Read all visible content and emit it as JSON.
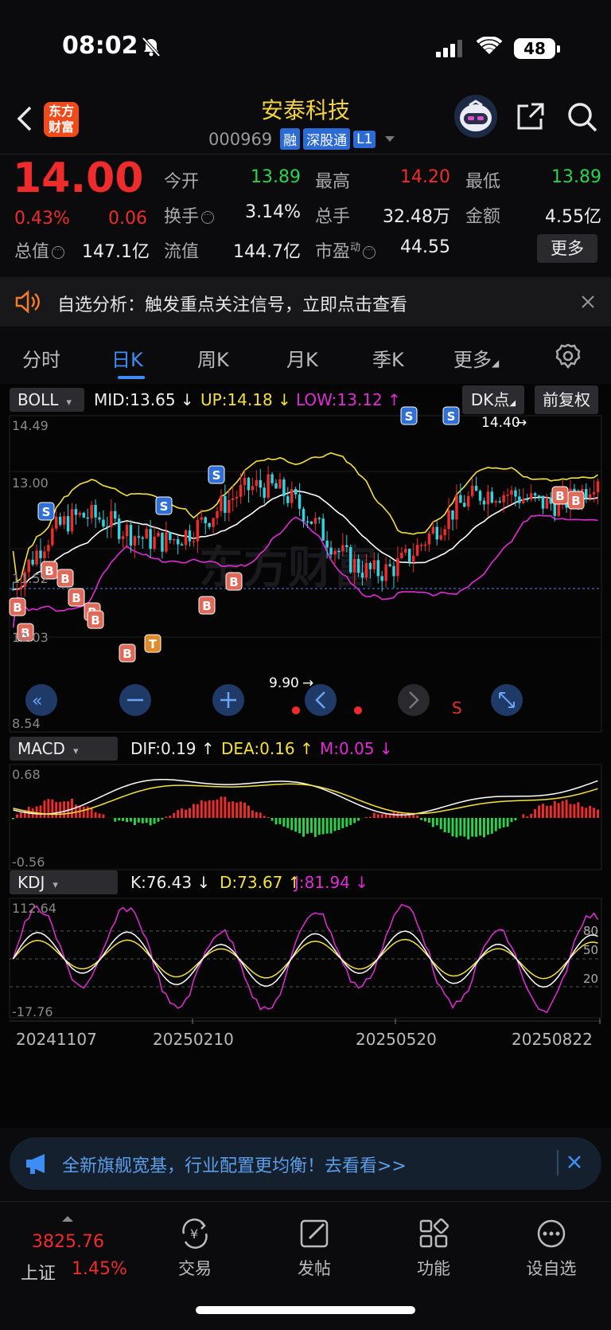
{
  "status": {
    "time": "08:02",
    "battery": "48"
  },
  "header": {
    "logo_line1": "东方",
    "logo_line2": "财富",
    "stock_name": "安泰科技",
    "stock_code": "000969",
    "tags": [
      "融",
      "深股通",
      "L1"
    ]
  },
  "quote": {
    "price": "14.00",
    "change_pct": "0.43%",
    "change": "0.06",
    "fields": [
      {
        "label": "今开",
        "value": "13.89",
        "color": "#2bd34a"
      },
      {
        "label": "最高",
        "value": "14.20",
        "color": "#f02b2b"
      },
      {
        "label": "最低",
        "value": "13.89",
        "color": "#2bd34a"
      },
      {
        "label": "换手",
        "value": "3.14%",
        "color": "#eeeeee"
      },
      {
        "label": "总手",
        "value": "32.48万",
        "color": "#eeeeee"
      },
      {
        "label": "金额",
        "value": "4.55亿",
        "color": "#eeeeee"
      },
      {
        "label": "总值",
        "value": "147.1亿",
        "color": "#eeeeee"
      },
      {
        "label": "流值",
        "value": "144.7亿",
        "color": "#eeeeee"
      },
      {
        "label": "市盈",
        "value": "44.55",
        "color": "#eeeeee"
      }
    ],
    "pe_superscript": "动",
    "more_label": "更多"
  },
  "notice": {
    "text": "自选分析：触发重点关注信号，立即点击查看"
  },
  "tabs": [
    "分时",
    "日K",
    "周K",
    "月K",
    "季K",
    "更多"
  ],
  "active_tab": "日K",
  "boll": {
    "name": "BOLL",
    "mid": "MID:13.65",
    "up": "UP:14.18",
    "low": "LOW:13.12",
    "dk_label": "DK点",
    "fq_label": "前复权",
    "y_labels": [
      "14.49",
      "13.00",
      "11.52",
      "10.03",
      "8.54"
    ],
    "high_mark": "14.40",
    "low_mark": "9.90",
    "watermark": "东方财富"
  },
  "macd": {
    "name": "MACD",
    "dif": "DIF:0.19",
    "dea": "DEA:0.16",
    "m": "M:0.05",
    "y_top": "0.68",
    "y_bottom": "-0.56"
  },
  "kdj": {
    "name": "KDJ",
    "k": "K:76.43",
    "d": "D:73.67",
    "j": "J:81.94",
    "y_top": "112.64",
    "y_bottom": "-17.76",
    "right_labels": [
      "80",
      "50",
      "20"
    ]
  },
  "dates": [
    "20241107",
    "20250210",
    "20250520",
    "20250822"
  ],
  "chart_controls": {
    "s_label": "S"
  },
  "banner": {
    "text": "全新旗舰宽基，行业配置更均衡！去看看>>"
  },
  "bottom_nav": {
    "index_price": "3825.76",
    "index_name": "上证",
    "index_pct": "1.45%",
    "items": [
      "交易",
      "发帖",
      "功能",
      "设自选"
    ]
  },
  "colors": {
    "up": "#f02b2b",
    "down": "#2bd34a",
    "mid": "#ffffff",
    "upper": "#f5e13a",
    "lower": "#e22bd6",
    "candle_down": "#34d3e0"
  }
}
